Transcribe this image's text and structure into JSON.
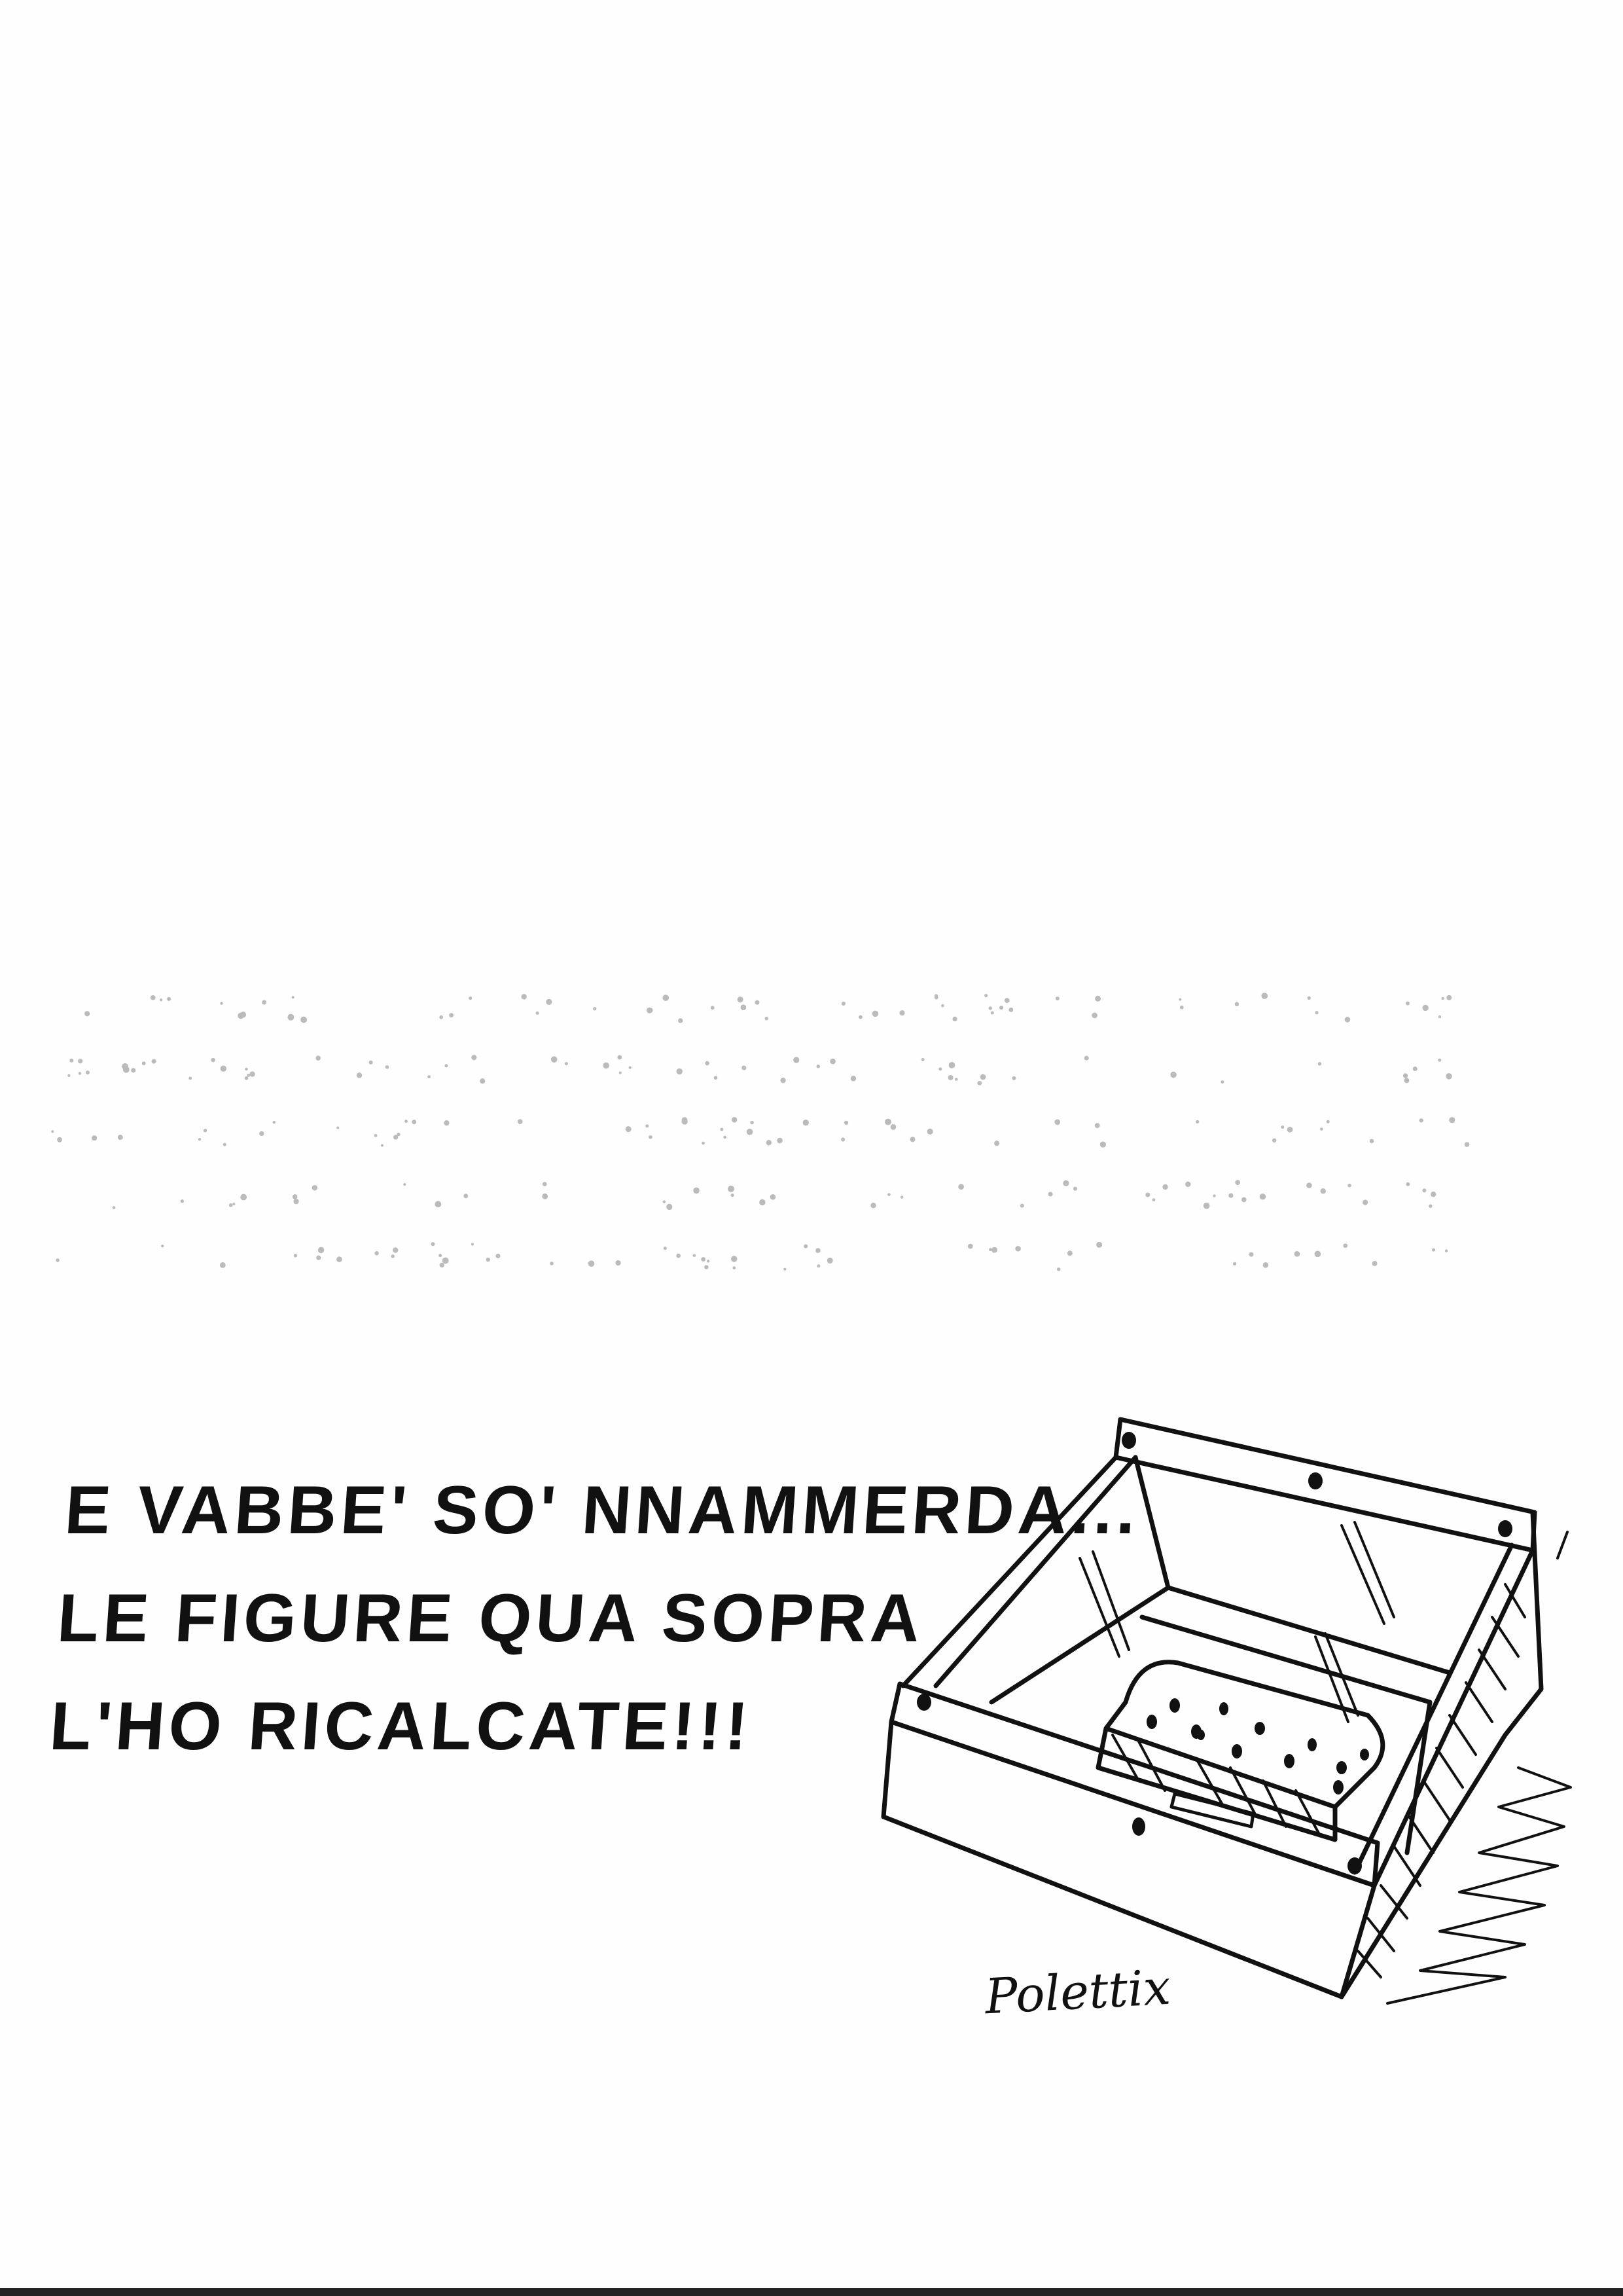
{
  "caption": {
    "lines": [
      "E VABBE' SO' NNAMMERDA...",
      "LE FIGURE QUA SOPRA",
      "L'HO RICALCATE!!!"
    ]
  },
  "signature": "Polettix",
  "colors": {
    "ink": "#111111",
    "paper": "#fefefe",
    "faint_dots": "#bbbbbb"
  }
}
